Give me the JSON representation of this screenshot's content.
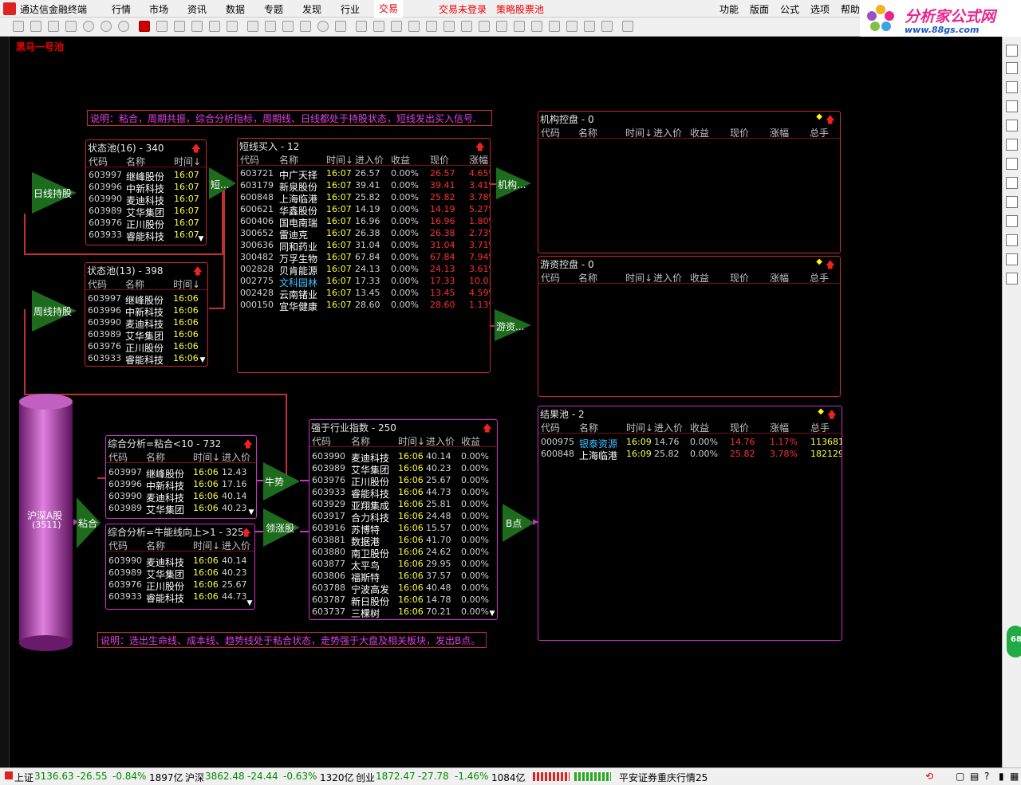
{
  "app": {
    "title": "通达信金融终端"
  },
  "menu": {
    "items": [
      "行情",
      "市场",
      "资讯",
      "数据",
      "专题",
      "发现",
      "行业",
      "交易"
    ],
    "active": "交易",
    "trade_login": "交易未登录",
    "strategy": "策略股票池",
    "right_items": [
      "功能",
      "版面",
      "公式",
      "选项",
      "帮助"
    ]
  },
  "brand": {
    "text": "分析家公式网",
    "url": "www.88gs.com"
  },
  "canvas": {
    "title": "黑马一号池"
  },
  "notes": {
    "top": "说明：粘合，周期共振，综合分析指标，周期线、日线都处于持股状态，短线发出买入信号.",
    "bottom": "说明：选出生命线、成本线、趋势线处于粘合状态，走势强于大盘及相关板块，发出B点。"
  },
  "nodes": {
    "daily_hold": "日线持股",
    "weekly_hold": "周线持股",
    "short": "短...",
    "institution": "机构...",
    "hot_money": "游资...",
    "bull": "牛势",
    "leading": "领涨股",
    "bpoint": "B点",
    "stick": "粘合",
    "market_name": "沪深A股",
    "market_count": "(3511)"
  },
  "panels": {
    "state16": {
      "title": "状态池(16) - 340",
      "headers": [
        "代码",
        "名称",
        "时间↓"
      ],
      "rows": [
        [
          "603997",
          "继峰股份",
          "16:07"
        ],
        [
          "603996",
          "中新科技",
          "16:07"
        ],
        [
          "603990",
          "麦迪科技",
          "16:07"
        ],
        [
          "603989",
          "艾华集团",
          "16:07"
        ],
        [
          "603976",
          "正川股份",
          "16:07"
        ],
        [
          "603933",
          "睿能科技",
          "16:07"
        ]
      ]
    },
    "state13": {
      "title": "状态池(13) - 398",
      "headers": [
        "代码",
        "名称",
        "时间↓"
      ],
      "rows": [
        [
          "603997",
          "继峰股份",
          "16:06"
        ],
        [
          "603996",
          "中新科技",
          "16:06"
        ],
        [
          "603990",
          "麦迪科技",
          "16:06"
        ],
        [
          "603989",
          "艾华集团",
          "16:06"
        ],
        [
          "603976",
          "正川股份",
          "16:06"
        ],
        [
          "603933",
          "睿能科技",
          "16:06"
        ]
      ]
    },
    "shortbuy": {
      "title": "短线买入 - 12",
      "headers": [
        "代码",
        "名称",
        "时间↓",
        "进入价",
        "收益",
        "现价",
        "涨幅"
      ],
      "rows": [
        [
          "603721",
          "中广天择",
          "16:07",
          "26.57",
          "0.00%",
          "26.57",
          "4.65%"
        ],
        [
          "603179",
          "新泉股份",
          "16:07",
          "39.41",
          "0.00%",
          "39.41",
          "3.41%"
        ],
        [
          "600848",
          "上海临港",
          "16:07",
          "25.82",
          "0.00%",
          "25.82",
          "3.78%"
        ],
        [
          "600621",
          "华鑫股份",
          "16:07",
          "14.19",
          "0.00%",
          "14.19",
          "5.27%"
        ],
        [
          "600406",
          "国电南瑞",
          "16:07",
          "16.96",
          "0.00%",
          "16.96",
          "1.80%"
        ],
        [
          "300652",
          "雷迪克",
          "16:07",
          "26.38",
          "0.00%",
          "26.38",
          "2.73%"
        ],
        [
          "300636",
          "同和药业",
          "16:07",
          "31.04",
          "0.00%",
          "31.04",
          "3.71%"
        ],
        [
          "300482",
          "万孚生物",
          "16:07",
          "67.84",
          "0.00%",
          "67.84",
          "7.94%"
        ],
        [
          "002828",
          "贝肯能源",
          "16:07",
          "24.13",
          "0.00%",
          "24.13",
          "3.61%"
        ],
        [
          "002775",
          "文科园林",
          "16:07",
          "17.33",
          "0.00%",
          "17.33",
          "10.03%"
        ],
        [
          "002428",
          "云南锗业",
          "16:07",
          "13.45",
          "0.00%",
          "13.45",
          "4.59%"
        ],
        [
          "000150",
          "宜华健康",
          "16:07",
          "28.60",
          "0.00%",
          "28.60",
          "1.13%"
        ]
      ]
    },
    "inst": {
      "title": "机构控盘 - 0",
      "headers": [
        "代码",
        "名称",
        "时间↓",
        "进入价",
        "收益",
        "现价",
        "涨幅",
        "总手"
      ]
    },
    "hot": {
      "title": "游资控盘 - 0",
      "headers": [
        "代码",
        "名称",
        "时间↓",
        "进入价",
        "收益",
        "现价",
        "涨幅",
        "总手"
      ]
    },
    "result": {
      "title": "结果池 - 2",
      "headers": [
        "代码",
        "名称",
        "时间↓",
        "进入价",
        "收益",
        "现价",
        "涨幅",
        "总手"
      ],
      "rows": [
        [
          "000975",
          "银泰资源",
          "16:09",
          "14.76",
          "0.00%",
          "14.76",
          "1.17%",
          "113681"
        ],
        [
          "600848",
          "上海临港",
          "16:09",
          "25.82",
          "0.00%",
          "25.82",
          "3.78%",
          "182129"
        ]
      ]
    },
    "comp1": {
      "title": "综合分析=粘合<10 - 732",
      "headers": [
        "代码",
        "名称",
        "时间↓",
        "进入价"
      ],
      "rows": [
        [
          "603997",
          "继峰股份",
          "16:06",
          "12.43"
        ],
        [
          "603996",
          "中新科技",
          "16:06",
          "17.16"
        ],
        [
          "603990",
          "麦迪科技",
          "16:06",
          "40.14"
        ],
        [
          "603989",
          "艾华集团",
          "16:06",
          "40.23"
        ]
      ]
    },
    "comp2": {
      "title": "综合分析=牛能线向上>1 - 325",
      "headers": [
        "代码",
        "名称",
        "时间↓",
        "进入价"
      ],
      "rows": [
        [
          "603990",
          "麦迪科技",
          "16:06",
          "40.14"
        ],
        [
          "603989",
          "艾华集团",
          "16:06",
          "40.23"
        ],
        [
          "603976",
          "正川股份",
          "16:06",
          "25.67"
        ],
        [
          "603933",
          "睿能科技",
          "16:06",
          "44.73"
        ]
      ]
    },
    "strong": {
      "title": "强于行业指数 - 250",
      "headers": [
        "代码",
        "名称",
        "时间↓",
        "进入价",
        "收益"
      ],
      "rows": [
        [
          "603990",
          "麦迪科技",
          "16:06",
          "40.14",
          "0.00%"
        ],
        [
          "603989",
          "艾华集团",
          "16:06",
          "40.23",
          "0.00%"
        ],
        [
          "603976",
          "正川股份",
          "16:06",
          "25.67",
          "0.00%"
        ],
        [
          "603933",
          "睿能科技",
          "16:06",
          "44.73",
          "0.00%"
        ],
        [
          "603929",
          "亚翔集成",
          "16:06",
          "25.81",
          "0.00%"
        ],
        [
          "603917",
          "合力科技",
          "16:06",
          "24.48",
          "0.00%"
        ],
        [
          "603916",
          "苏博特",
          "16:06",
          "15.57",
          "0.00%"
        ],
        [
          "603881",
          "数据港",
          "16:06",
          "41.70",
          "0.00%"
        ],
        [
          "603880",
          "南卫股份",
          "16:06",
          "24.62",
          "0.00%"
        ],
        [
          "603877",
          "太平鸟",
          "16:06",
          "29.95",
          "0.00%"
        ],
        [
          "603806",
          "福斯特",
          "16:06",
          "37.57",
          "0.00%"
        ],
        [
          "603788",
          "宁波高发",
          "16:06",
          "40.48",
          "0.00%"
        ],
        [
          "603787",
          "新日股份",
          "16:06",
          "14.78",
          "0.00%"
        ],
        [
          "603737",
          "三棵树",
          "16:06",
          "70.21",
          "0.00%"
        ]
      ]
    }
  },
  "status": {
    "sh_label": "上证",
    "sh_val": "3136.63",
    "sh_chg": "-26.55",
    "sh_pct": "-0.84%",
    "sh_amt": "1897亿",
    "hs_label": "沪深",
    "hs_val": "3862.48",
    "hs_chg": "-24.44",
    "hs_pct": "-0.63%",
    "hs_amt": "1320亿",
    "cy_label": "创业",
    "cy_val": "1872.47",
    "cy_chg": "-27.78",
    "cy_pct": "-1.46%",
    "cy_amt": "1084亿",
    "broker": "平安证券重庆行情25",
    "badge": "68"
  },
  "colors": {
    "panel_border": "#c82828",
    "magenta": "#d030d0",
    "arrow_green": "#1d6b1d"
  }
}
